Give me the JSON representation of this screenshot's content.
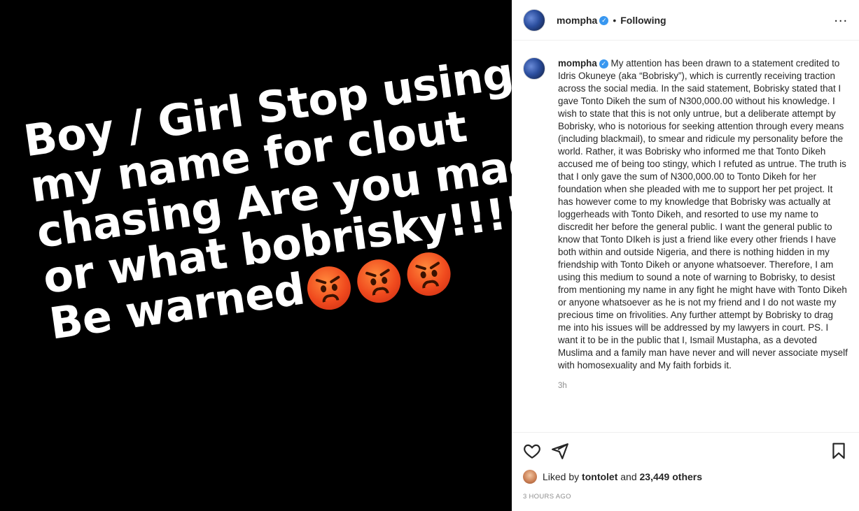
{
  "media": {
    "lines": [
      "Boy / Girl Stop using",
      "my name for clout",
      "chasing Are you mad",
      "or what bobrisky!!!!",
      "Be warned"
    ],
    "emoji_icons": [
      "angry-face-icon",
      "angry-face-icon",
      "angry-face-icon"
    ]
  },
  "header": {
    "username": "mompha",
    "separator": "•",
    "follow_status": "Following",
    "more_icon": "more-options-icon"
  },
  "caption": {
    "username": "mompha",
    "text": "My attention has been drawn to a statement credited to Idris Okuneye (aka “Bobrisky”), which is currently receiving traction across the social media. In the said statement, Bobrisky stated that I gave Tonto Dikeh the sum of N300,000.00 without his knowledge. I wish to state that this is not only untrue, but a deliberate attempt by Bobrisky, who is notorious for seeking attention through every means (including blackmail), to smear and ridicule my personality before the world. Rather, it was Bobrisky who informed me that Tonto Dikeh accused me of being too stingy, which I refuted as untrue. The truth is that I only gave the sum of N300,000.00 to Tonto Dikeh for her foundation when she pleaded with me to support her pet project. It has however come to my knowledge that Bobrisky was actually at loggerheads with Tonto Dikeh, and resorted to use my name to discredit her before the general public. I want the general public to know that Tonto DIkeh is just a friend like every other friends I have both within and outside Nigeria, and there is nothing hidden in my friendship with Tonto Dikeh or anyone whatsoever. Therefore, I am using this medium to sound a note of warning to Bobrisky, to desist from mentioning my name in any fight he might have with Tonto Dikeh or anyone whatsoever as he is not my friend and I do not waste my precious time on frivolities. Any further attempt by Bobrisky to drag me into his issues will be addressed by my lawyers in court. PS. I want it to be in the public that I, Ismail Mustapha, as a devoted Muslima and a family man have never and will never associate myself with homosexuality and My faith forbids it.",
    "time": "3h"
  },
  "actions": {
    "like_icon": "heart-icon",
    "share_icon": "paper-plane-icon",
    "save_icon": "bookmark-icon"
  },
  "likes": {
    "prefix": "Liked by",
    "user": "tontolet",
    "middle": "and",
    "count": "23,449 others"
  },
  "post_age": "3 HOURS AGO",
  "colors": {
    "media_bg": "#000000",
    "text_primary": "#262626",
    "text_secondary": "#8e8e8e",
    "verified": "#3897f0",
    "divider": "#efefef"
  }
}
